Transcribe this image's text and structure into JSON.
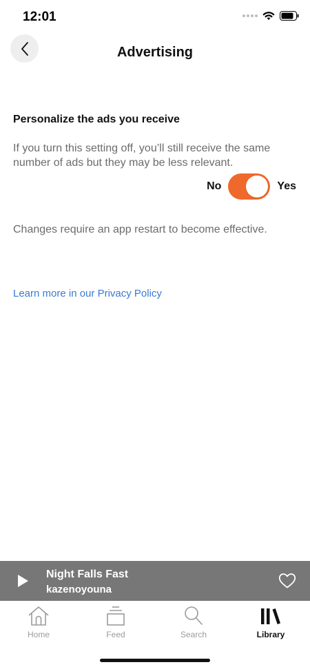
{
  "status_bar": {
    "time": "12:01"
  },
  "header": {
    "title": "Advertising",
    "back_icon": "chevron-left-icon"
  },
  "content": {
    "heading": "Personalize the ads you receive",
    "description": "If you turn this setting off, you’ll still receive the same number of ads but they may be less relevant.",
    "toggle": {
      "off_label": "No",
      "on_label": "Yes",
      "value": true,
      "color": "#f0692c"
    },
    "restart_note": "Changes require an app restart to become effective.",
    "privacy_link": "Learn more in our Privacy Policy",
    "link_color": "#3a79d8"
  },
  "mini_player": {
    "title": "Night Falls Fast",
    "artist": "kazenoyouna",
    "play_icon": "play-icon",
    "favorite_icon": "heart-icon",
    "background": "#777777"
  },
  "tab_bar": {
    "active": "library",
    "tabs": [
      {
        "id": "home",
        "label": "Home",
        "icon": "home-icon"
      },
      {
        "id": "feed",
        "label": "Feed",
        "icon": "feed-icon"
      },
      {
        "id": "search",
        "label": "Search",
        "icon": "search-icon"
      },
      {
        "id": "library",
        "label": "Library",
        "icon": "library-icon"
      }
    ]
  }
}
